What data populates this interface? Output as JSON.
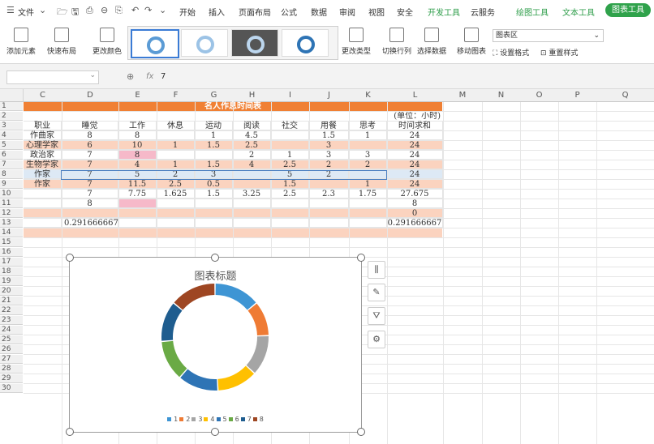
{
  "menubar": {
    "file_label": "文件",
    "tabs": [
      "开始",
      "插入",
      "页面布局",
      "公式",
      "数据",
      "审阅",
      "视图",
      "安全",
      "开发工具",
      "云服务",
      "绘图工具",
      "文本工具",
      "图表工具"
    ]
  },
  "toolbar": {
    "add_element": "添加元素",
    "quick_layout": "快速布局",
    "change_color": "更改颜色",
    "change_type": "更改类型",
    "switch_rowcol": "切换行列",
    "select_data": "选择数据",
    "move_chart": "移动图表",
    "chart_area": "图表区",
    "set_format": "设置格式",
    "reset_style": "重置样式"
  },
  "formula": {
    "fx": "fx",
    "value": "7"
  },
  "columns": [
    "C",
    "D",
    "E",
    "F",
    "G",
    "H",
    "I",
    "J",
    "K",
    "L",
    "M",
    "N",
    "O",
    "P",
    "Q"
  ],
  "rows": [
    "1",
    "2",
    "3",
    "4",
    "5",
    "6",
    "7",
    "8",
    "9",
    "10",
    "11",
    "12",
    "13",
    "14",
    "15",
    "16",
    "17",
    "18",
    "19",
    "20",
    "21",
    "22",
    "23",
    "24",
    "25",
    "26",
    "27",
    "28",
    "29",
    "30"
  ],
  "sheet": {
    "title": "名人作息时间表",
    "unit": "(单位：小时)",
    "headers": [
      "职业",
      "睡觉",
      "工作",
      "休息",
      "运动",
      "阅读",
      "社交",
      "用餐",
      "思考",
      "时间求和"
    ],
    "data": [
      [
        "作曲家",
        "8",
        "8",
        "",
        "1",
        "4.5",
        "",
        "1.5",
        "1",
        "24"
      ],
      [
        "心理学家",
        "6",
        "10",
        "1",
        "1.5",
        "2.5",
        "",
        "3",
        "",
        "24"
      ],
      [
        "政治家",
        "7",
        "8",
        "",
        "",
        "2",
        "1",
        "3",
        "3",
        "24"
      ],
      [
        "生物学家",
        "7",
        "4",
        "1",
        "1.5",
        "4",
        "2.5",
        "2",
        "2",
        "24"
      ],
      [
        "作家",
        "7",
        "5",
        "2",
        "3",
        "",
        "5",
        "2",
        "",
        "24"
      ],
      [
        "作家",
        "7",
        "11.5",
        "2.5",
        "0.5",
        "",
        "1.5",
        "",
        "1",
        "24"
      ],
      [
        "",
        "7",
        "7.75",
        "1.625",
        "1.5",
        "3.25",
        "2.5",
        "2.3",
        "1.75",
        "27.675"
      ],
      [
        "",
        "8",
        "",
        "",
        "",
        "",
        "",
        "",
        "",
        "8"
      ],
      [
        "",
        "",
        "",
        "",
        "",
        "",
        "",
        "",
        "",
        "0"
      ],
      [
        "",
        "0.291666667",
        "",
        "",
        "",
        "",
        "",
        "",
        "",
        "0.291666667"
      ]
    ]
  },
  "chart": {
    "title": "图表标题",
    "legend": [
      "1",
      "2",
      "3",
      "4",
      "5",
      "6",
      "7",
      "8"
    ]
  },
  "chart_data": {
    "type": "pie",
    "title": "图表标题",
    "categories": [
      "1",
      "2",
      "3",
      "4",
      "5",
      "6",
      "7",
      "8"
    ],
    "values": [
      8,
      6,
      7,
      7,
      7,
      7,
      7,
      8
    ],
    "colors": [
      "#3e95d4",
      "#ef7b34",
      "#a5a5a5",
      "#ffc000",
      "#2e74b5",
      "#6aaa45",
      "#1f5d8f",
      "#9e4622"
    ],
    "donut": true
  }
}
